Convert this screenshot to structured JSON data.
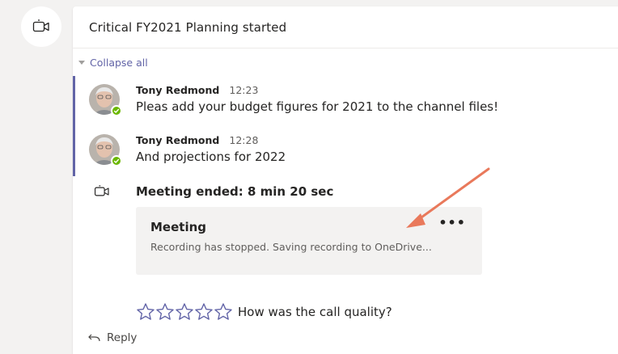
{
  "post": {
    "title": "Critical FY2021 Planning started",
    "collapse_label": "Collapse all"
  },
  "messages": [
    {
      "author": "Tony Redmond",
      "time": "12:23",
      "text": "Pleas add your budget figures for 2021 to the channel files!"
    },
    {
      "author": "Tony Redmond",
      "time": "12:28",
      "text": "And projections for 2022"
    }
  ],
  "meeting": {
    "ended_text": "Meeting ended: 8 min 20 sec",
    "card_title": "Meeting",
    "card_status": "Recording has stopped. Saving recording to OneDrive...",
    "more_label": "•••"
  },
  "rating": {
    "question": "How was the call quality?",
    "star_count": 5
  },
  "reply_label": "Reply",
  "colors": {
    "accent": "#6264a7",
    "presence": "#6bb700",
    "arrow": "#e9795b"
  },
  "icons": {
    "post_type": "video-camera-icon",
    "meeting_ended": "video-camera-icon",
    "reply": "reply-arrow-icon",
    "more": "more-options-icon"
  }
}
